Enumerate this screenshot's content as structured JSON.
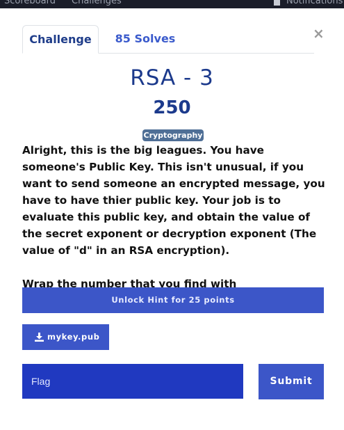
{
  "background_nav": {
    "links": [
      "Scoreboard",
      "Challenges",
      "Notifications"
    ]
  },
  "tabs": [
    {
      "label": "Challenge",
      "active": true
    },
    {
      "label": "85 Solves",
      "active": false
    }
  ],
  "close_label": "×",
  "challenge": {
    "title": "RSA - 3",
    "points": "250",
    "category": "Cryptography",
    "description": [
      "Alright, this is the big leagues. You have someone's Public Key. This isn't unusual, if you want to send someone an encrypted message, you have to have thier public key. Your job is to evaluate this public key, and obtain the value of the secret exponent or decryption exponent (The value of \"d\" in an RSA encryption).",
      "Wrap the number that you find with dsc{<number>}!"
    ]
  },
  "hint_button": "Unlock Hint for 25 points",
  "file": {
    "name": "mykey.pub",
    "icon": "download-icon"
  },
  "flag_input": {
    "placeholder": "Flag",
    "value": ""
  },
  "submit_label": "Submit",
  "colors": {
    "primary": "#3c56c8",
    "input_bg": "#2039c0",
    "title": "#1c3a8c",
    "tag": "#4f6f96"
  }
}
